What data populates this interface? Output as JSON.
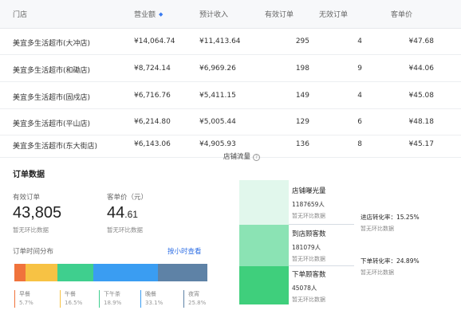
{
  "table": {
    "headers": {
      "store": "门店",
      "revenue": "营业额",
      "expected_income": "预计收入",
      "valid_orders": "有效订单",
      "invalid_orders": "无效订单",
      "avg_order_value": "客单价"
    },
    "rows": [
      {
        "store": "美宜多生活超市(大冲店)",
        "revenue": "¥14,064.74",
        "expected_income": "¥11,413.64",
        "valid_orders": "295",
        "invalid_orders": "4",
        "avg_order_value": "¥47.68"
      },
      {
        "store": "美宜多生活超市(和磡店)",
        "revenue": "¥8,724.14",
        "expected_income": "¥6,969.26",
        "valid_orders": "198",
        "invalid_orders": "9",
        "avg_order_value": "¥44.06"
      },
      {
        "store": "美宜多生活超市(固戍店)",
        "revenue": "¥6,716.76",
        "expected_income": "¥5,411.15",
        "valid_orders": "149",
        "invalid_orders": "4",
        "avg_order_value": "¥45.08"
      },
      {
        "store": "美宜多生活超市(平山店)",
        "revenue": "¥6,214.80",
        "expected_income": "¥5,005.44",
        "valid_orders": "129",
        "invalid_orders": "6",
        "avg_order_value": "¥48.18"
      },
      {
        "store": "美宜多生活超市(东大街店)",
        "revenue": "¥6,143.06",
        "expected_income": "¥4,905.93",
        "valid_orders": "136",
        "invalid_orders": "8",
        "avg_order_value": "¥45.17"
      }
    ]
  },
  "order_data": {
    "title": "订单数据",
    "valid_orders": {
      "label": "有效订单",
      "value": "43,805",
      "note": "暂无环比数据"
    },
    "avg_price": {
      "label": "客单价（元）",
      "value_int": "44",
      "value_dec": ".61",
      "note": "暂无环比数据"
    },
    "distribution": {
      "title": "订单时间分布",
      "link": "按小时查看",
      "segments": [
        {
          "name": "早餐",
          "pct": "5.7%",
          "fraction": 0.057,
          "color": "#f0733c"
        },
        {
          "name": "午餐",
          "pct": "16.5%",
          "fraction": 0.165,
          "color": "#f7c244"
        },
        {
          "name": "下午茶",
          "pct": "18.9%",
          "fraction": 0.189,
          "color": "#3fcf8e"
        },
        {
          "name": "晚餐",
          "pct": "33.1%",
          "fraction": 0.331,
          "color": "#3a9df2"
        },
        {
          "name": "夜宵",
          "pct": "25.8%",
          "fraction": 0.258,
          "color": "#5e82a6"
        }
      ]
    }
  },
  "store_traffic": {
    "title": "店铺流量",
    "steps": [
      {
        "name": "店铺曝光量",
        "count": "1187659人",
        "note": "暂无环比数据",
        "color": "#e1f7ec"
      },
      {
        "name": "到店顾客数",
        "count": "181079人",
        "note": "暂无环比数据",
        "color": "#8be3b4"
      },
      {
        "name": "下单顾客数",
        "count": "45078人",
        "note": "暂无环比数据",
        "color": "#3fcf7c"
      }
    ],
    "conversions": [
      {
        "label": "进店转化率：15.25%",
        "note": "暂无环比数据"
      },
      {
        "label": "下单转化率：24.89%",
        "note": "暂无环比数据"
      }
    ]
  }
}
